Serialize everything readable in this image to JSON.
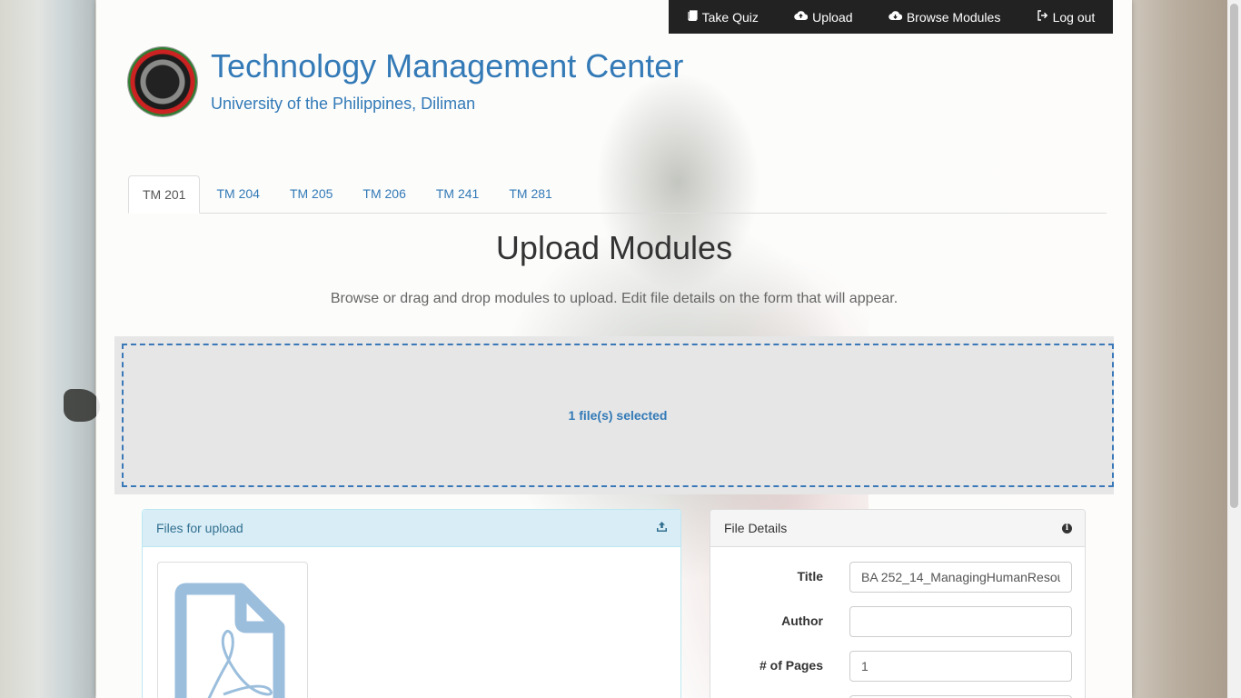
{
  "nav": {
    "items": [
      {
        "label": "Take Quiz",
        "icon": "book-icon"
      },
      {
        "label": "Upload",
        "icon": "cloud-upload-icon"
      },
      {
        "label": "Browse Modules",
        "icon": "cloud-download-icon"
      },
      {
        "label": "Log out",
        "icon": "sign-out-icon"
      }
    ]
  },
  "header": {
    "title": "Technology Management Center",
    "subtitle": "University of the Philippines, Diliman"
  },
  "tabs": [
    {
      "label": "TM 201",
      "active": true
    },
    {
      "label": "TM 204",
      "active": false
    },
    {
      "label": "TM 205",
      "active": false
    },
    {
      "label": "TM 206",
      "active": false
    },
    {
      "label": "TM 241",
      "active": false
    },
    {
      "label": "TM 281",
      "active": false
    }
  ],
  "main": {
    "heading": "Upload Modules",
    "instruction": "Browse or drag and drop modules to upload. Edit file details on the form that will appear.",
    "dropzone_status": "1 file(s) selected"
  },
  "files_panel": {
    "title": "Files for upload",
    "file_type_icon": "pdf-file-icon"
  },
  "details_panel": {
    "title": "File Details",
    "fields": {
      "title": {
        "label": "Title",
        "value": "BA 252_14_ManagingHumanResou"
      },
      "author": {
        "label": "Author",
        "value": ""
      },
      "pages": {
        "label": "# of Pages",
        "value": "1"
      }
    }
  },
  "colors": {
    "link": "#337ab7",
    "navbar": "#222222",
    "dropzone_border": "#3a78b8",
    "info_panel_heading": "#d9edf7"
  }
}
